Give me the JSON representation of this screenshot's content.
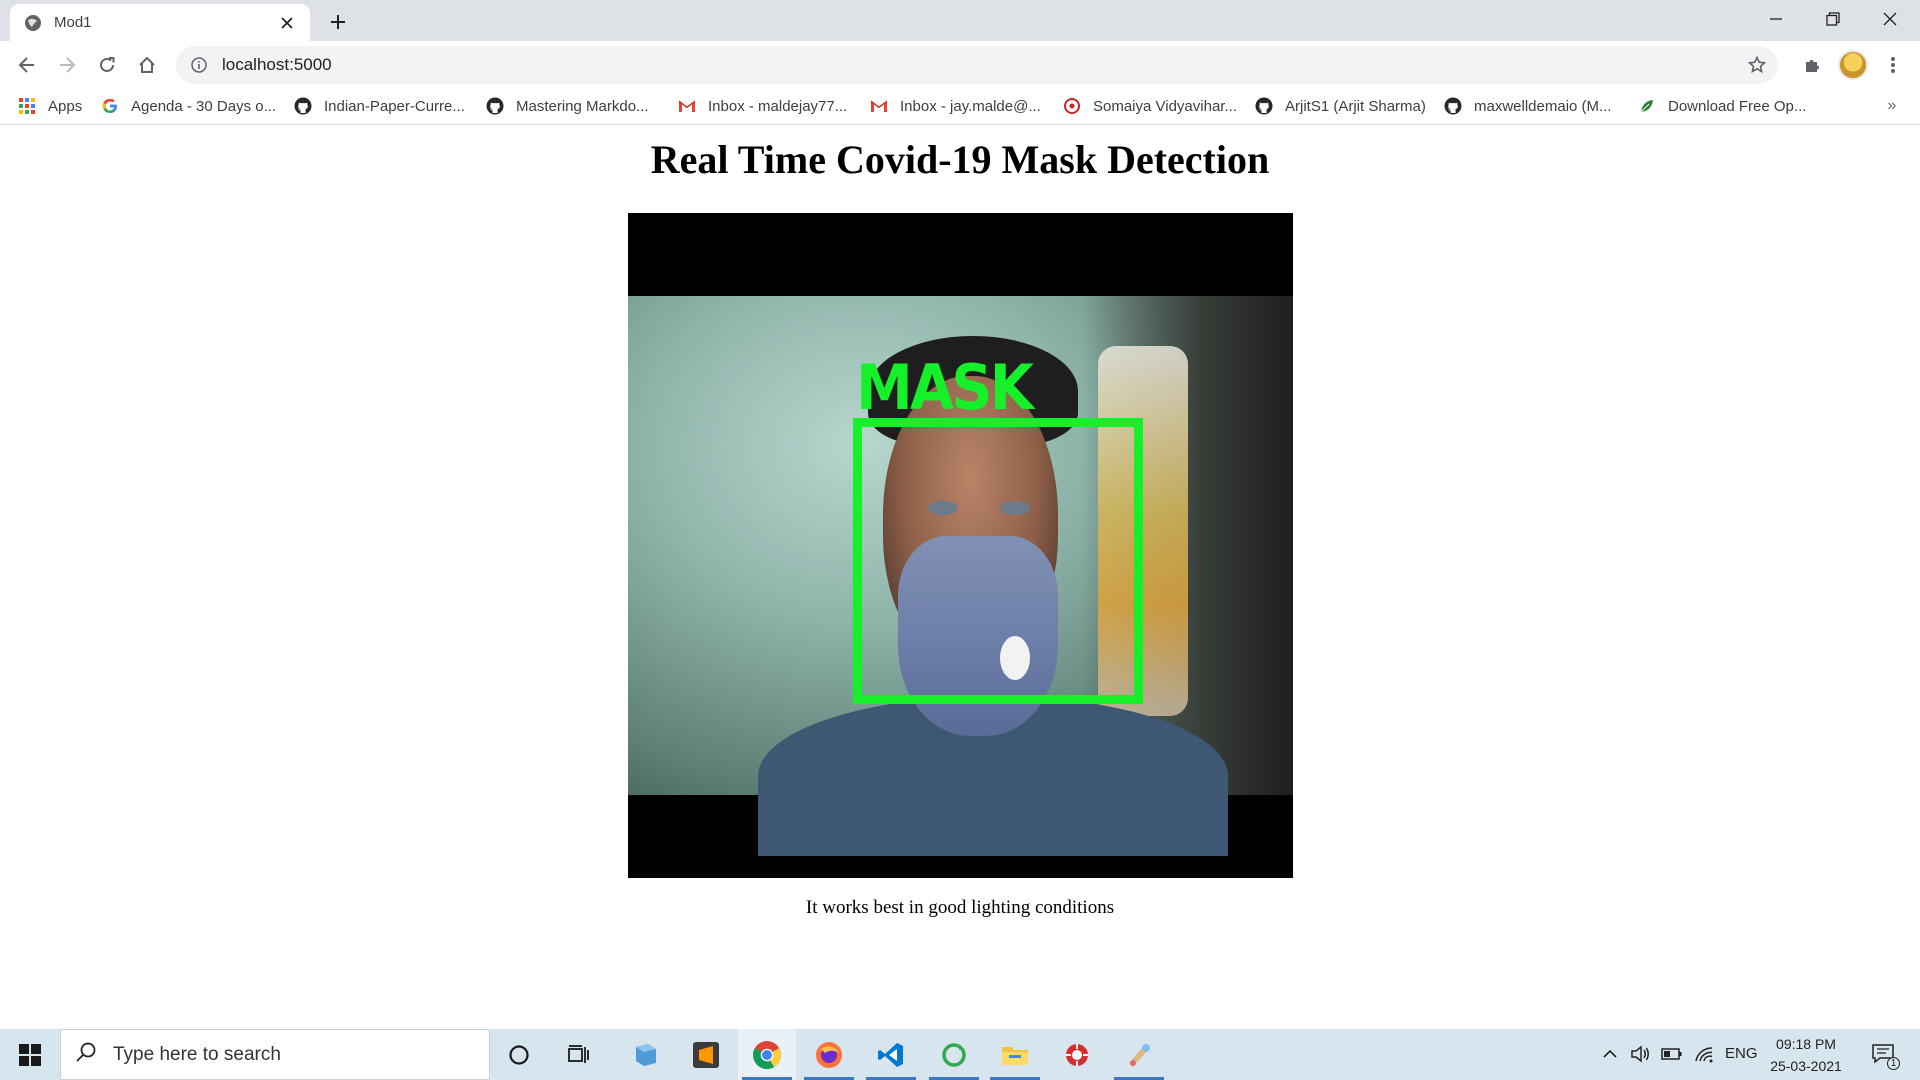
{
  "browser": {
    "tab_title": "Mod1",
    "url": "localhost:5000",
    "bookmarks": [
      {
        "label": "Apps",
        "icon": "apps-grid-icon"
      },
      {
        "label": "Agenda - 30 Days o...",
        "icon": "google-icon"
      },
      {
        "label": "Indian-Paper-Curre...",
        "icon": "github-icon"
      },
      {
        "label": "Mastering Markdo...",
        "icon": "github-icon"
      },
      {
        "label": "Inbox - maldejay77...",
        "icon": "gmail-icon"
      },
      {
        "label": "Inbox - jay.malde@...",
        "icon": "gmail-icon"
      },
      {
        "label": "Somaiya Vidyavihar...",
        "icon": "somaiya-icon"
      },
      {
        "label": "ArjitS1 (Arjit Sharma)",
        "icon": "github-icon"
      },
      {
        "label": "maxwelldemaio (M...",
        "icon": "github-icon"
      },
      {
        "label": "Download Free Op...",
        "icon": "leaf-icon"
      }
    ],
    "bookmarks_overflow": "»"
  },
  "page": {
    "title": "Real Time Covid-19 Mask Detection",
    "detection_label": "MASK",
    "caption": "It works best in good lighting conditions"
  },
  "taskbar": {
    "search_placeholder": "Type here to search",
    "language": "ENG",
    "time": "09:18 PM",
    "date": "25-03-2021",
    "notification_count": "1"
  },
  "colors": {
    "detection": "#16f02a",
    "tabstrip": "#dee1e6",
    "taskbar": "#d7e5ef"
  }
}
